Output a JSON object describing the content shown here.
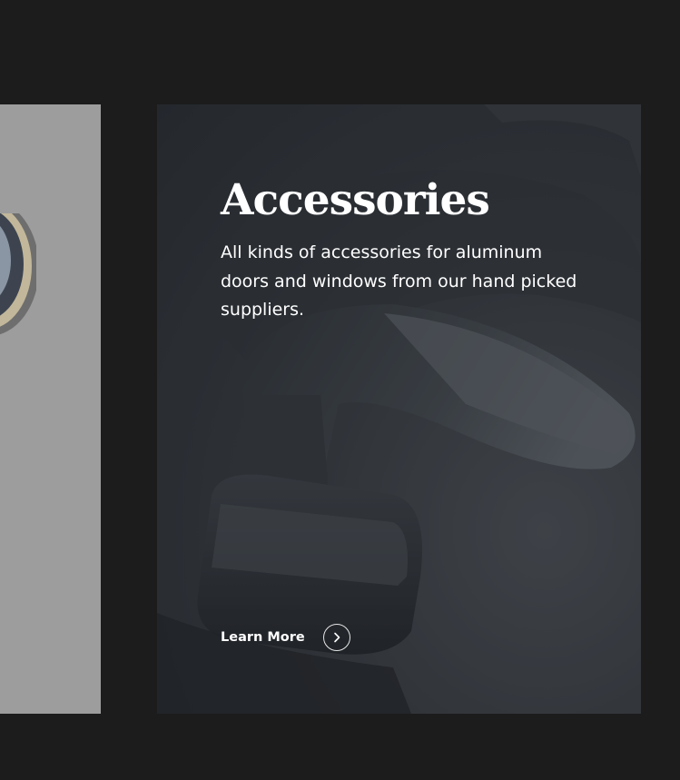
{
  "left_card": {
    "image": "door-handle-ring-image"
  },
  "card": {
    "title": "Accessories",
    "description": "All kinds of accessories for aluminum doors and windows from our hand picked suppliers.",
    "cta_label": "Learn More",
    "cta_icon": "chevron-right-icon",
    "background_image": "lever-door-handle-photo"
  },
  "colors": {
    "page_bg": "#1c1c1c",
    "left_card_bg": "#9d9d9d",
    "text": "#ffffff"
  }
}
